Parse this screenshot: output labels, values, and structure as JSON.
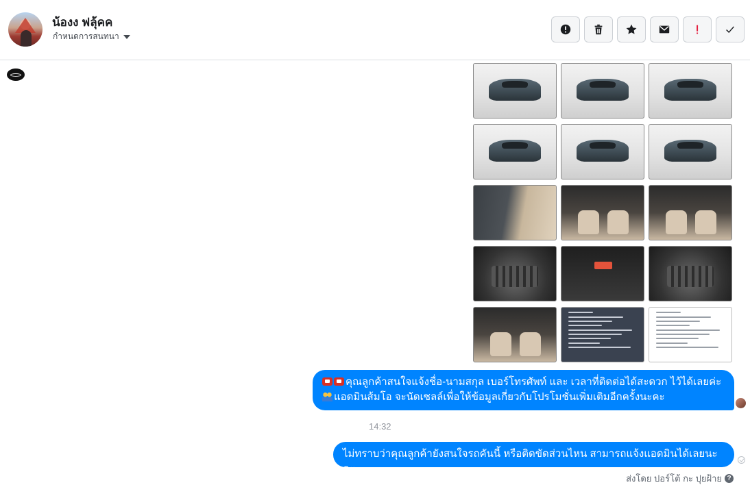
{
  "header": {
    "name": "น้องง ฟลุ้คค",
    "assign_label": "กำหนดการสนทนา",
    "actions": [
      {
        "icon": "alert-circle-icon"
      },
      {
        "icon": "trash-icon"
      },
      {
        "icon": "star-icon"
      },
      {
        "icon": "envelope-icon"
      },
      {
        "icon": "exclamation-icon",
        "color": "#e41e3f"
      },
      {
        "icon": "checkmark-icon"
      }
    ]
  },
  "photos": [
    {
      "kind": "ext"
    },
    {
      "kind": "ext"
    },
    {
      "kind": "ext"
    },
    {
      "kind": "ext"
    },
    {
      "kind": "ext"
    },
    {
      "kind": "ext"
    },
    {
      "kind": "door"
    },
    {
      "kind": "int"
    },
    {
      "kind": "int"
    },
    {
      "kind": "eng"
    },
    {
      "kind": "dash"
    },
    {
      "kind": "eng"
    },
    {
      "kind": "int"
    },
    {
      "kind": "doc-dark"
    },
    {
      "kind": "doc-light"
    }
  ],
  "messages": [
    {
      "line1": "คุณลูกค้าสนใจแจ้งชื่อ-นามสกุล เบอร์โทรศัพท์ และ เวลาที่ติดต่อได้สะดวก ไว้ได้เลยค่ะ",
      "line2": "แอดมินส้มโอ จะนัดเซลล์เพื่อให้ข้อมูลเกี่ยวกับโปรโมชั่นเพิ่มเติมอีกครั้งนะคะ"
    },
    {
      "text": "ไม่ทราบว่าคุณลูกค้ายังสนใจรถคันนี้ หรือติดขัดส่วนไหน สามารถแจ้งแอดมินได้เลยนะคะ"
    }
  ],
  "timestamp": "14:32",
  "sent_by": "ส่งโดย ปอร์โต้ กะ ปุยฝ้าย",
  "colors": {
    "bubble": "#0084ff",
    "accent_red": "#e41e3f"
  }
}
